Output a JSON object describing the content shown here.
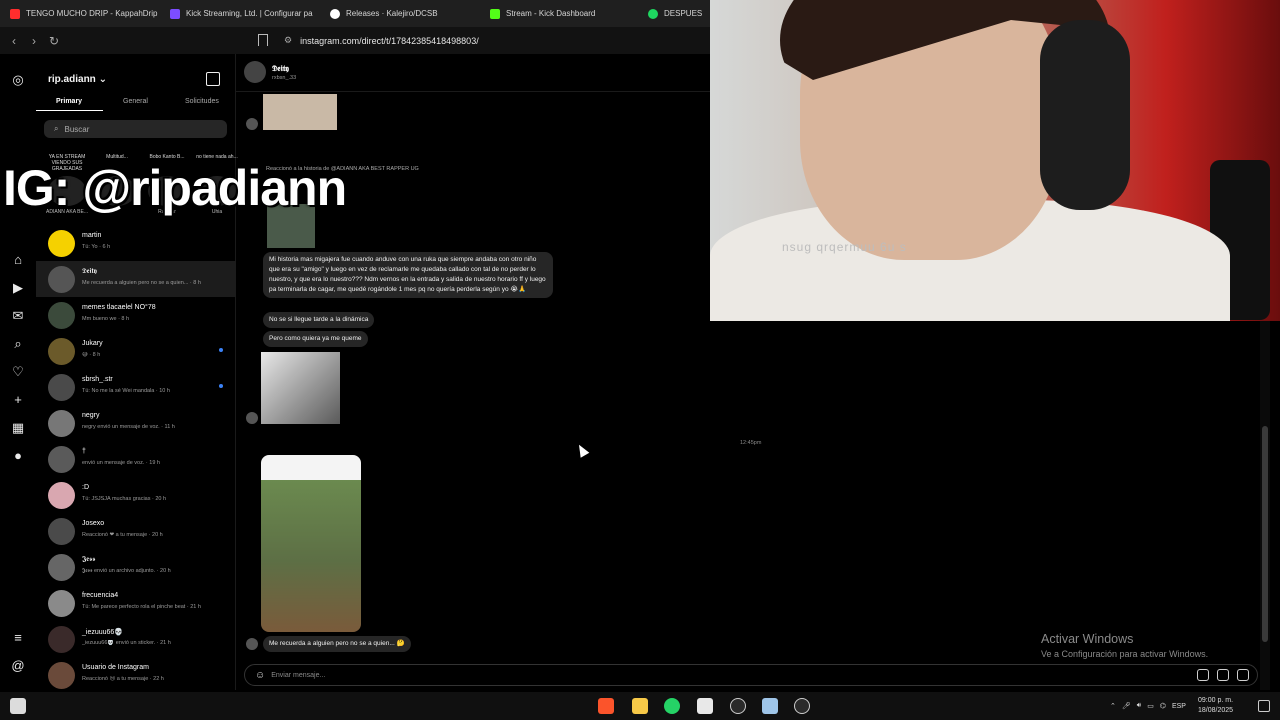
{
  "browser": {
    "tabs": [
      {
        "label": "TENGO MUCHO DRIP - KappahDrip",
        "color": "#ff2d2d"
      },
      {
        "label": "Kick Streaming, Ltd. | Configurar pa",
        "color": "#7c4dff"
      },
      {
        "label": "Releases · Kalejiro/DCSB",
        "color": "#ffffff"
      },
      {
        "label": "Stream - Kick Dashboard",
        "color": "#53fc18"
      },
      {
        "label": "DESPUES",
        "color": "#1ed760"
      }
    ],
    "url": "instagram.com/direct/t/17842385418498803/"
  },
  "sidebar_rail": {
    "icons": [
      "instagram-icon",
      "home-icon",
      "reels-icon",
      "explore-icon",
      "search-icon",
      "heart-icon",
      "create-icon",
      "dashboard-icon",
      "profile-icon",
      "menu-icon",
      "threads-icon"
    ]
  },
  "inbox": {
    "account": "rip.adiann",
    "tabs": [
      "Primary",
      "General",
      "Solicitudes"
    ],
    "search_placeholder": "Buscar",
    "notes": [
      {
        "text": "YA EN STREAM VIENDO SUS GRAJEADAS",
        "name": "ADIANN AKA BE..."
      },
      {
        "text": "Multitud...",
        "name": ""
      },
      {
        "text": "Bobo Kanto B...",
        "name": "Rambar"
      },
      {
        "text": "no tiene nada ah...",
        "name": "Uhia"
      }
    ],
    "conversations": [
      {
        "name": "martin",
        "preview": "Tú: Yo · 6 h",
        "color": "#f5d100",
        "active": false,
        "unread": false
      },
      {
        "name": "𝕯𝖊𝖎𝖙𝖞",
        "preview": "Me recuerda a alguien pero no se a quien... · 8 h",
        "color": "#555555",
        "active": true,
        "unread": false
      },
      {
        "name": "memes tlacaelel NO°78",
        "preview": "Mm bueno we · 8 h",
        "color": "#3b4a3b",
        "active": false,
        "unread": false
      },
      {
        "name": "Jukary",
        "preview": "😅 · 8 h",
        "color": "#6b5a2a",
        "active": false,
        "unread": true
      },
      {
        "name": "sbrsh_.str",
        "preview": "Tú: No me la sé Wei mandala · 10 h",
        "color": "#4a4a4a",
        "active": false,
        "unread": true
      },
      {
        "name": "negry",
        "preview": "negry envió un mensaje de voz. · 11 h",
        "color": "#777777",
        "active": false,
        "unread": false
      },
      {
        "name": "†",
        "preview": "envió un mensaje de voz. · 19 h",
        "color": "#5a5a5a",
        "active": false,
        "unread": false
      },
      {
        "name": ":D",
        "preview": "Tú: JSJSJA muchas gracias · 20 h",
        "color": "#d9a7b0",
        "active": false,
        "unread": false
      },
      {
        "name": "Josexo",
        "preview": "Reaccionó ❤ a tu mensaje · 20 h",
        "color": "#4a4a4a",
        "active": false,
        "unread": false
      },
      {
        "name": "𝕵𝖊𝖘𝖘",
        "preview": "𝕵𝖊𝖘𝖘 envió un archivo adjunto. · 20 h",
        "color": "#666666",
        "active": false,
        "unread": false
      },
      {
        "name": "frecuencia4",
        "preview": "Tú: Me parece perfecto rola el pinche beat · 21 h",
        "color": "#8a8a8a",
        "active": false,
        "unread": false
      },
      {
        "name": "_iezuuu66💀",
        "preview": "_iezuuu66💀 envió un sticker. · 21 h",
        "color": "#3a2a2a",
        "active": false,
        "unread": false
      },
      {
        "name": "Usuario de Instagram",
        "preview": "Reaccionó 😢 a tu mensaje · 22 h",
        "color": "#6a4a3a",
        "active": false,
        "unread": false
      }
    ]
  },
  "chat": {
    "header_name": "𝕯𝖊𝖎𝖙𝖞",
    "header_sub": "rxbsn_.33",
    "reply_label": "Reaccionó a la historia de @ADIANN AKA BEST RAPPER UG",
    "messages": [
      "Mi historia mas migajera fue cuando anduve con una ruka que siempre andaba con otro niño que era su \"amigo\" y luego en vez de reclamarle me quedaba callado con tal de no perder lo nuestro, y que era lo nuestro??? Ndm vernos en la entrada y salida de nuestro horario ff y luego pa terminarla de cagar, me quedé rogándole 1 mes pq no quería perderla según yo 😭🙏",
      "No se si llegue tarde a la dinámica",
      "Pero como quiera ya me queme",
      "Me recuerda a alguien pero no se a quien... 🤔"
    ],
    "timestamp": "12:45pm",
    "input_placeholder": "Enviar mensaje..."
  },
  "overlay": {
    "ig_handle": "IG: @ripadiann",
    "shirt_text": "nsug qrqermuu 6u s",
    "activate_title": "Activar Windows",
    "activate_sub": "Ve a Configuración para activar Windows."
  },
  "taskbar": {
    "lang": "ESP",
    "time": "09:00 p. m.",
    "date": "18/08/2025"
  }
}
